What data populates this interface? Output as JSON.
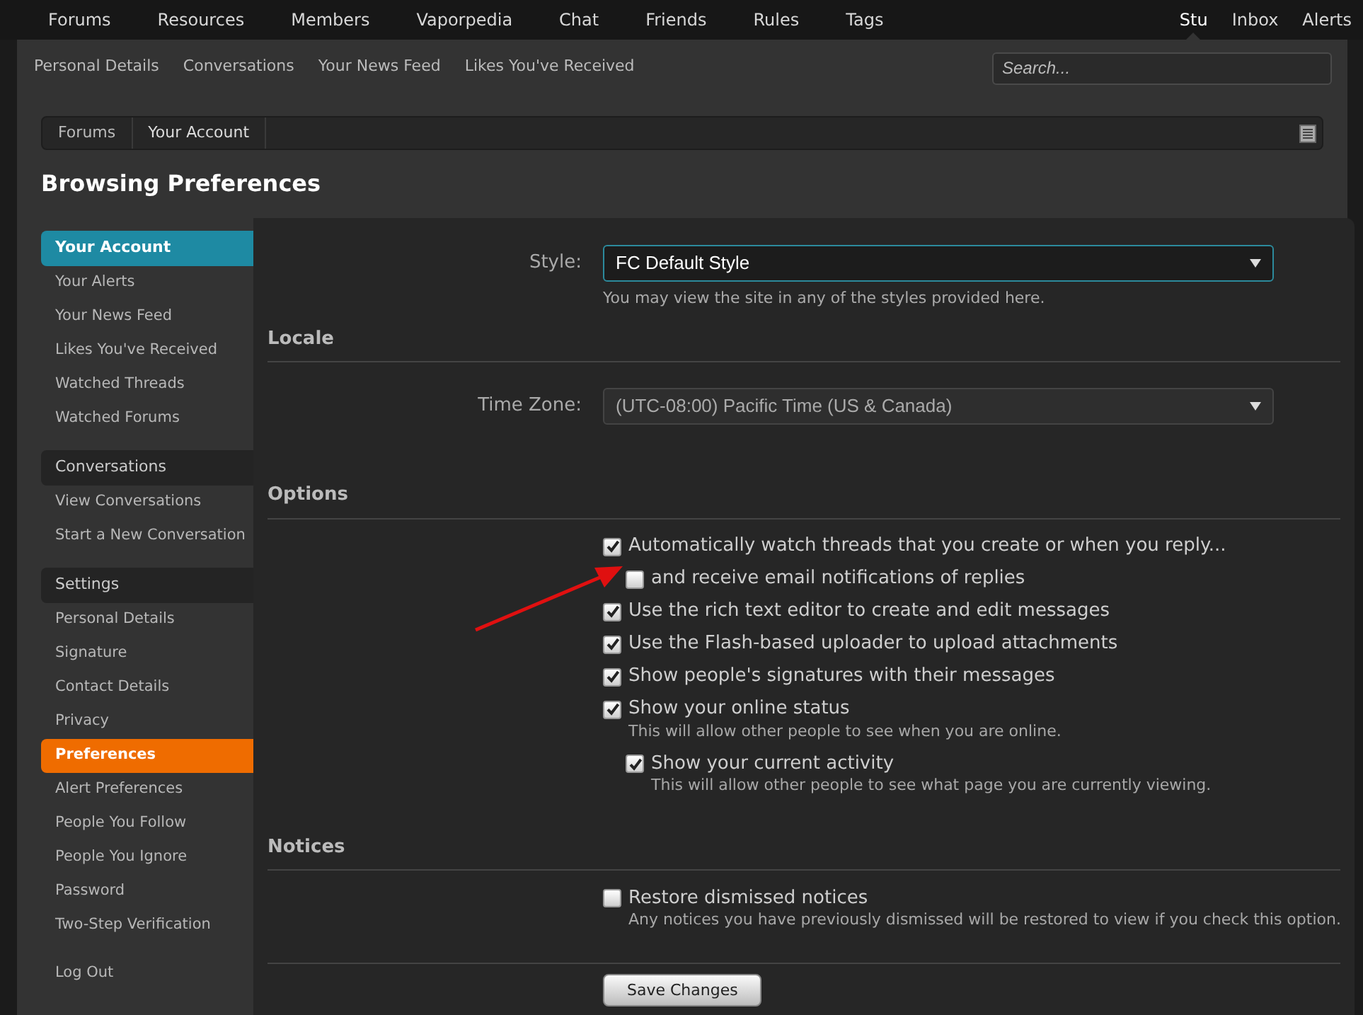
{
  "top_nav": {
    "items": [
      {
        "label": "Forums",
        "selected": false
      },
      {
        "label": "Resources",
        "selected": false
      },
      {
        "label": "Members",
        "selected": false
      },
      {
        "label": "Vaporpedia",
        "selected": false
      },
      {
        "label": "Chat",
        "selected": false
      },
      {
        "label": "Friends",
        "selected": false
      },
      {
        "label": "Rules",
        "selected": false
      },
      {
        "label": "Tags",
        "selected": false
      }
    ],
    "user_items": [
      {
        "label": "Stu",
        "selected": true
      },
      {
        "label": "Inbox",
        "selected": false
      },
      {
        "label": "Alerts",
        "selected": false
      }
    ]
  },
  "sub_nav": [
    "Personal Details",
    "Conversations",
    "Your News Feed",
    "Likes You've Received"
  ],
  "search": {
    "placeholder": "Search..."
  },
  "breadcrumb": [
    "Forums",
    "Your Account"
  ],
  "page_title": "Browsing Preferences",
  "sidebar": {
    "sections": [
      {
        "heading": "Your Account",
        "selected": true,
        "items": [
          {
            "label": "Your Alerts",
            "selected": false
          },
          {
            "label": "Your News Feed",
            "selected": false
          },
          {
            "label": "Likes You've Received",
            "selected": false
          },
          {
            "label": "Watched Threads",
            "selected": false
          },
          {
            "label": "Watched Forums",
            "selected": false
          }
        ]
      },
      {
        "heading": "Conversations",
        "selected": false,
        "items": [
          {
            "label": "View Conversations",
            "selected": false
          },
          {
            "label": "Start a New Conversation",
            "selected": false
          }
        ]
      },
      {
        "heading": "Settings",
        "selected": false,
        "items": [
          {
            "label": "Personal Details",
            "selected": false
          },
          {
            "label": "Signature",
            "selected": false
          },
          {
            "label": "Contact Details",
            "selected": false
          },
          {
            "label": "Privacy",
            "selected": false
          },
          {
            "label": "Preferences",
            "selected": true
          },
          {
            "label": "Alert Preferences",
            "selected": false
          },
          {
            "label": "People You Follow",
            "selected": false
          },
          {
            "label": "People You Ignore",
            "selected": false
          },
          {
            "label": "Password",
            "selected": false
          },
          {
            "label": "Two-Step Verification",
            "selected": false
          }
        ]
      },
      {
        "items": [
          {
            "label": "Log Out",
            "selected": false
          }
        ]
      }
    ]
  },
  "form": {
    "style": {
      "label": "Style:",
      "value": "FC Default Style",
      "hint": "You may view the site in any of the styles provided here."
    },
    "sections": [
      {
        "heading": "Locale",
        "rows": [
          {
            "kind": "select",
            "label": "Time Zone:",
            "value": "(UTC-08:00) Pacific Time (US & Canada)"
          }
        ]
      },
      {
        "heading": "Options",
        "rows": [
          {
            "kind": "checkbox",
            "label": "Automatically watch threads that you create or when you reply...",
            "checked": true,
            "children": [
              {
                "kind": "checkbox",
                "label": "and receive email notifications of replies",
                "checked": false
              }
            ]
          },
          {
            "kind": "checkbox",
            "label": "Use the rich text editor to create and edit messages",
            "checked": true
          },
          {
            "kind": "checkbox",
            "label": "Use the Flash-based uploader to upload attachments",
            "checked": true
          },
          {
            "kind": "checkbox",
            "label": "Show people's signatures with their messages",
            "checked": true
          },
          {
            "kind": "checkbox",
            "label": "Show your online status",
            "checked": true,
            "hint": "This will allow other people to see when you are online.",
            "children": [
              {
                "kind": "checkbox",
                "label": "Show your current activity",
                "checked": true,
                "hint": "This will allow other people to see what page you are currently viewing."
              }
            ]
          }
        ]
      },
      {
        "heading": "Notices",
        "rows": [
          {
            "kind": "checkbox",
            "label": "Restore dismissed notices",
            "checked": false,
            "hint": "Any notices you have previously dismissed will be restored to view if you check this option."
          }
        ]
      }
    ],
    "save_button": "Save Changes"
  }
}
